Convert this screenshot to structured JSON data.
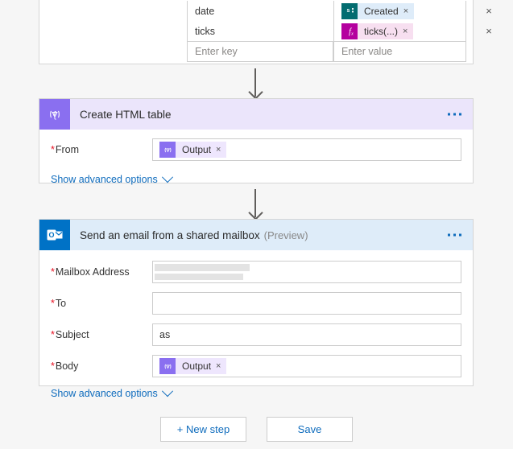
{
  "colors": {
    "page_bg": "#f6f6f6",
    "card_bg": "#ffffff",
    "purple_accent": "#8a6ff0",
    "purple_header": "#ebe5fb",
    "blue_accent": "#0072c6",
    "blue_header": "#deecf9",
    "link": "#0f6cbd",
    "required_asterisk": "#e81123",
    "sharepoint_icon": "#036c70",
    "expression_icon": "#b4009e"
  },
  "parameters_card": {
    "table": {
      "rows": [
        {
          "key": "date",
          "value_token": "Created",
          "token_icon": "sharepoint-icon",
          "delete_label": "×"
        },
        {
          "key": "ticks",
          "value_token": "ticks(...)",
          "token_icon": "expression-icon",
          "delete_label": "×"
        }
      ],
      "new_row": {
        "key_placeholder": "Enter key",
        "value_placeholder": "Enter value"
      },
      "token_remove_label": "×"
    }
  },
  "create_html_table_card": {
    "icon": "data-operation-icon",
    "icon_glyph": "{∇}",
    "title": "Create HTML table",
    "menu_label": "more-commands",
    "fields": [
      {
        "label": "From",
        "required": true,
        "token": {
          "text": "Output",
          "icon_glyph": "{∇}",
          "remove_label": "×"
        }
      }
    ],
    "advanced_link": "Show advanced options"
  },
  "send_email_card": {
    "icon": "outlook-icon",
    "title": "Send an email from a shared mailbox",
    "subtitle": "(Preview)",
    "menu_label": "more-commands",
    "fields": [
      {
        "label": "Mailbox Address",
        "required": true,
        "value": "",
        "redacted": true
      },
      {
        "label": "To",
        "required": true,
        "value": "",
        "redacted": true
      },
      {
        "label": "Subject",
        "required": true,
        "value": "as",
        "redacted": false
      },
      {
        "label": "Body",
        "required": true,
        "value": "",
        "token": {
          "text": "Output",
          "icon_glyph": "{∇}",
          "remove_label": "×"
        }
      }
    ],
    "advanced_link": "Show advanced options"
  },
  "footer": {
    "new_step_label": "+ New step",
    "save_label": "Save"
  }
}
